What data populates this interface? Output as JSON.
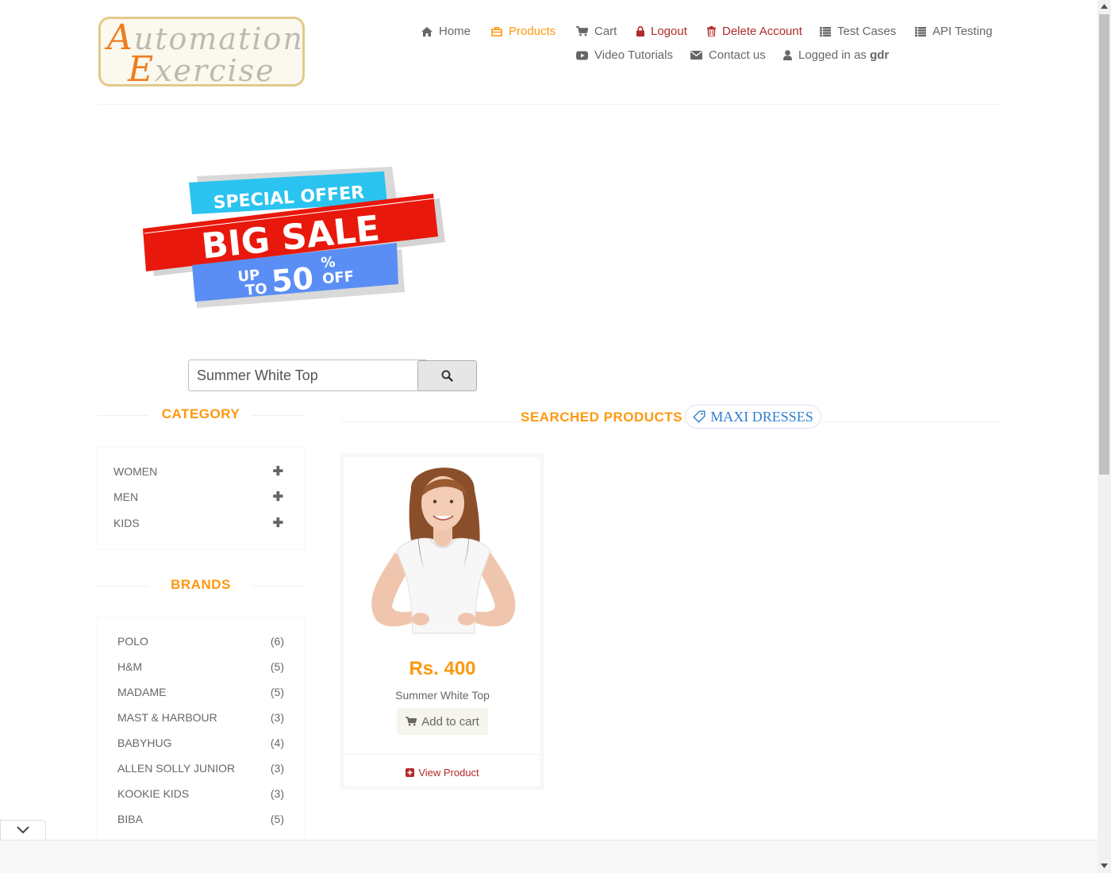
{
  "logo": {
    "line1_cap": "A",
    "line1_rest": "utomation",
    "line2_cap": "E",
    "line2_rest": "xercise"
  },
  "nav": {
    "home": "Home",
    "products": "Products",
    "cart": "Cart",
    "logout": "Logout",
    "delete_account": "Delete Account",
    "test_cases": "Test Cases",
    "api_testing": "API Testing",
    "video_tutorials": "Video Tutorials",
    "contact_us": "Contact us",
    "logged_in_prefix": "Logged in as",
    "username": "gdr"
  },
  "banner": {
    "line1": "SPECIAL OFFER",
    "line2": "BIG SALE",
    "up": "UP",
    "to": "TO",
    "number": "50",
    "percent": "%",
    "off": "OFF"
  },
  "search": {
    "value": "Summer White Top"
  },
  "category": {
    "title": "CATEGORY",
    "items": [
      {
        "label": "WOMEN"
      },
      {
        "label": "MEN"
      },
      {
        "label": "KIDS"
      }
    ]
  },
  "brands": {
    "title": "BRANDS",
    "items": [
      {
        "name": "POLO",
        "count": "(6)"
      },
      {
        "name": "H&M",
        "count": "(5)"
      },
      {
        "name": "MADAME",
        "count": "(5)"
      },
      {
        "name": "MAST & HARBOUR",
        "count": "(3)"
      },
      {
        "name": "BABYHUG",
        "count": "(4)"
      },
      {
        "name": "ALLEN SOLLY JUNIOR",
        "count": "(3)"
      },
      {
        "name": "KOOKIE KIDS",
        "count": "(3)"
      },
      {
        "name": "BIBA",
        "count": "(5)"
      }
    ]
  },
  "results": {
    "title": "SEARCHED PRODUCTS",
    "tag": "MAXI DRESSES",
    "product": {
      "price": "Rs. 400",
      "name": "Summer White Top",
      "add_to_cart": "Add to cart",
      "view_product": "View Product"
    }
  },
  "colors": {
    "accent": "#fe980f",
    "danger": "#b12a2a",
    "tag_blue": "#2f7fd0"
  }
}
